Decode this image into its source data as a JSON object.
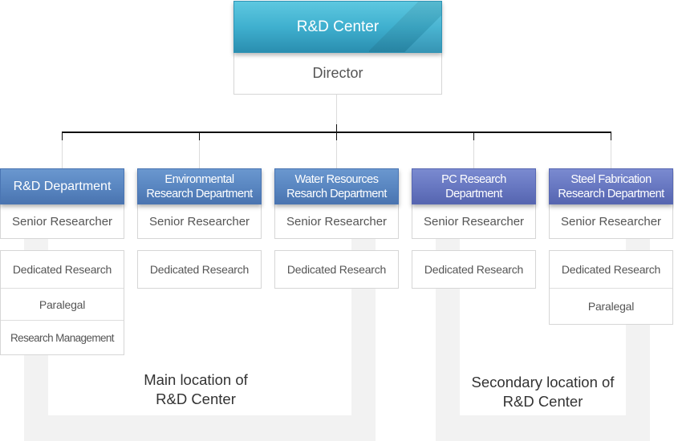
{
  "center": {
    "title": "R&D Center",
    "role": "Director",
    "color": "#3fb0cf"
  },
  "departments": [
    {
      "name": "R&D Department",
      "color": "#5885c0",
      "senior": "Senior Researcher",
      "subunits": [
        "Dedicated Research",
        "Paralegal",
        "Research Management"
      ]
    },
    {
      "name_line1": "Environmental",
      "name_line2": "Research Department",
      "color": "#5885c0",
      "senior": "Senior Researcher",
      "subunits": [
        "Dedicated Research"
      ]
    },
    {
      "name_line1": "Water Resources",
      "name_line2": "Resarch Department",
      "color": "#5885c0",
      "senior": "Senior Researcher",
      "subunits": [
        "Dedicated Research"
      ]
    },
    {
      "name_line1": "PC Research",
      "name_line2": "Department",
      "color": "#6676c0",
      "senior": "Senior Researcher",
      "subunits": [
        "Dedicated Research"
      ]
    },
    {
      "name_line1": "Steel Fabrication",
      "name_line2": "Research Department",
      "color": "#6676c0",
      "senior": "Senior Researcher",
      "subunits": [
        "Dedicated Research",
        "Paralegal"
      ]
    }
  ],
  "locations": {
    "main": {
      "line1": "Main location of",
      "line2": "R&D Center"
    },
    "secondary": {
      "line1": "Secondary location of",
      "line2": "R&D Center"
    }
  }
}
